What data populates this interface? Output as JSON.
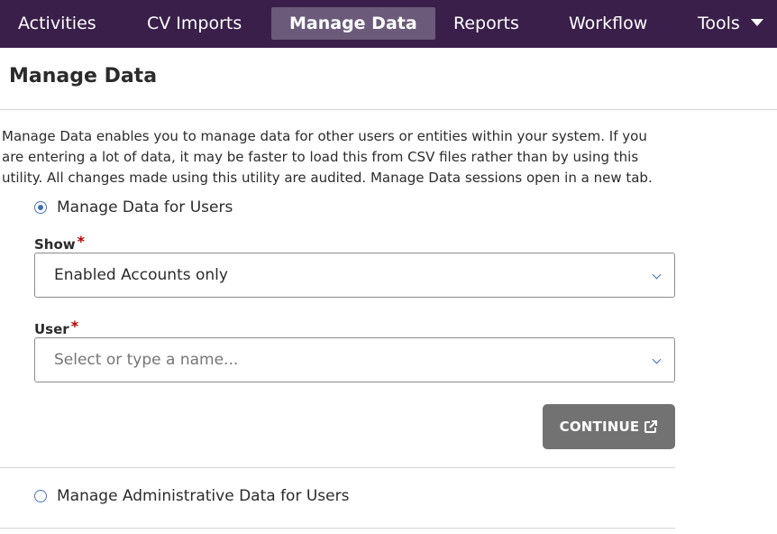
{
  "nav": {
    "items": [
      {
        "label": "Activities"
      },
      {
        "label": "CV Imports"
      },
      {
        "label": "Manage Data",
        "active": true
      },
      {
        "label": "Reports"
      },
      {
        "label": "Workflow"
      },
      {
        "label": "Tools"
      }
    ],
    "tools_icon": "caret-down-icon"
  },
  "page": {
    "title": "Manage Data",
    "intro": "Manage Data enables you to manage data for other users or entities within your system. If you are entering a lot of data, it may be faster to load this from CSV files rather than by using this utility. All changes made using this utility are audited. Manage Data sessions open in a new tab."
  },
  "options": {
    "users_label": "Manage Data for Users",
    "users_selected": true,
    "admin_label": "Manage Administrative Data for Users",
    "admin_selected": false
  },
  "form": {
    "show_label": "Show",
    "show_value": "Enabled Accounts only",
    "user_label": "User",
    "user_placeholder": "Select or type a name...",
    "required_mark": "*"
  },
  "continue": {
    "label": "CONTINUE",
    "icon": "external-link-icon"
  },
  "colors": {
    "nav_bg": "#3a1f4a",
    "nav_active_bg": "#6b5a79",
    "accent": "#3b6fb6",
    "button_bg": "#727272",
    "required": "#b30000"
  }
}
